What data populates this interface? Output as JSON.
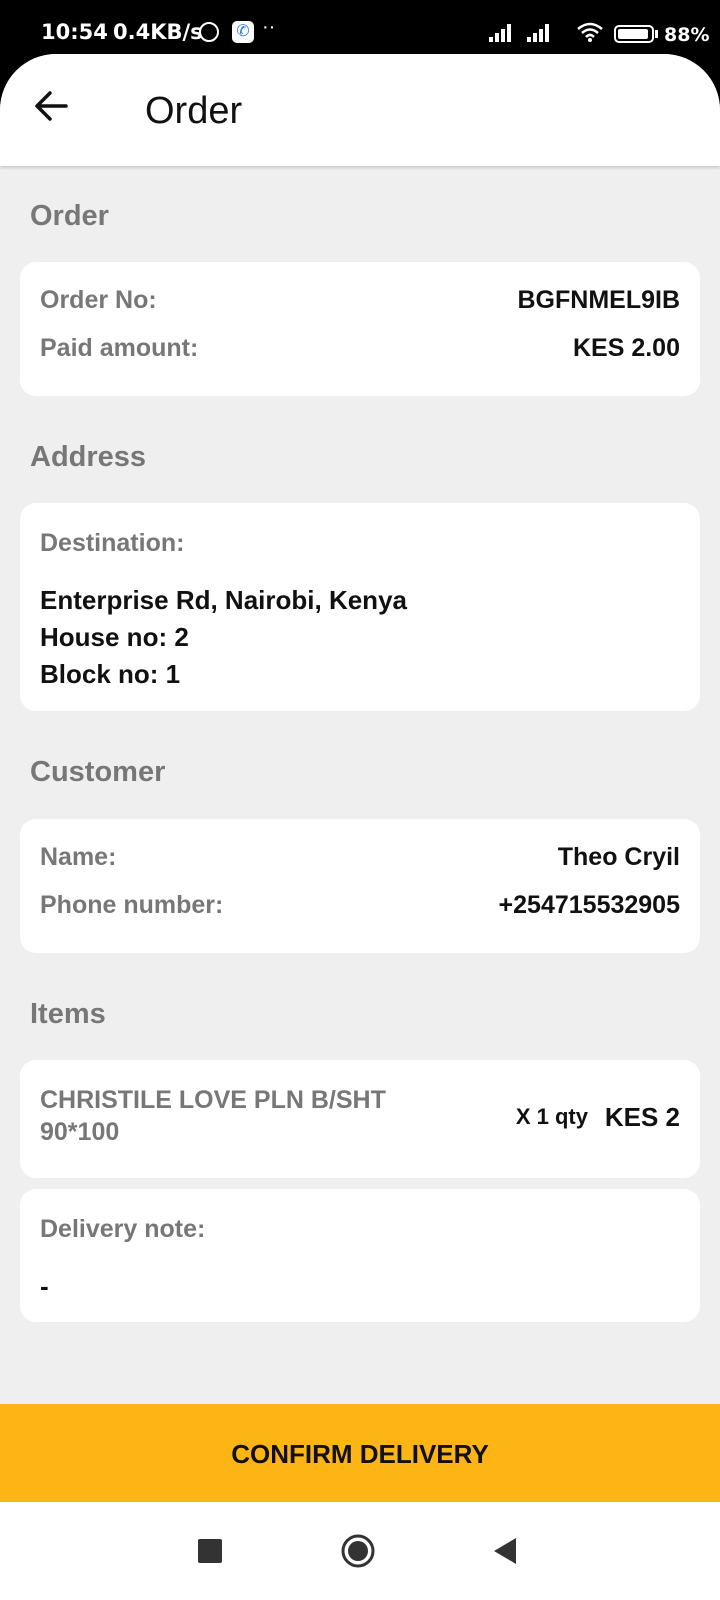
{
  "status_bar": {
    "time": "10:54",
    "speed": "0.4KB/s",
    "dots": "··",
    "battery": "88%"
  },
  "appbar": {
    "title": "Order",
    "back_icon": "arrow-left-icon"
  },
  "order": {
    "section_title": "Order",
    "order_no_label": "Order No:",
    "order_no_value": "BGFNMEL9IB",
    "paid_label": "Paid amount:",
    "paid_value": "KES 2.00"
  },
  "address": {
    "section_title": "Address",
    "destination_label": "Destination:",
    "line1": "Enterprise Rd, Nairobi, Kenya",
    "line2": "House no: 2",
    "line3": "Block no: 1"
  },
  "customer": {
    "section_title": "Customer",
    "name_label": "Name:",
    "name_value": "Theo Cryil",
    "phone_label": "Phone number:",
    "phone_value": "+254715532905"
  },
  "items": {
    "section_title": "Items",
    "list": [
      {
        "name_line1": "CHRISTILE LOVE PLN B/SHT",
        "name_line2": "90*100",
        "qty": "X 1 qty",
        "price": "KES 2"
      }
    ]
  },
  "delivery_note": {
    "label": "Delivery note:",
    "value": "-"
  },
  "confirm_button": {
    "label": "CONFIRM DELIVERY",
    "color": "#fdb515"
  },
  "nav": {
    "recents_icon": "square-icon",
    "home_icon": "circle-icon",
    "back_icon": "triangle-back-icon"
  }
}
